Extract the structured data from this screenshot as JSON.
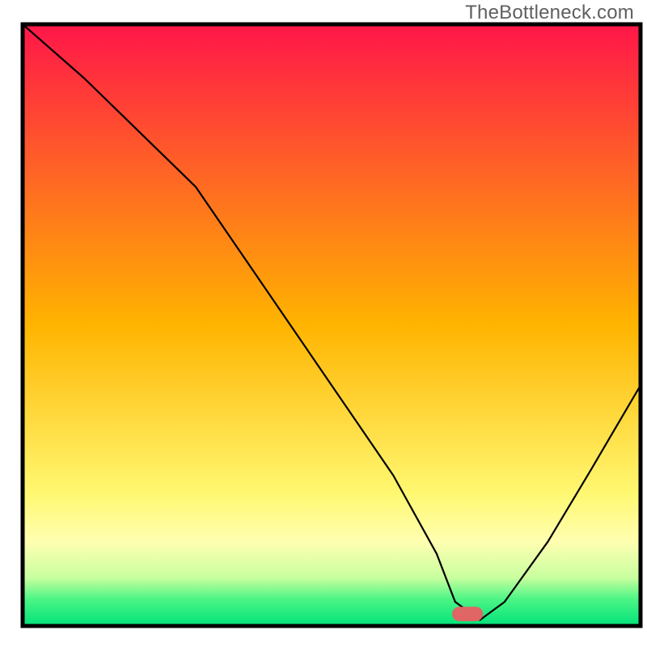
{
  "watermark": "TheBottleneck.com",
  "chart_data": {
    "type": "line",
    "title": "",
    "xlabel": "",
    "ylabel": "",
    "xlim": [
      0,
      100
    ],
    "ylim": [
      0,
      100
    ],
    "axes_visible": false,
    "border": true,
    "background_gradient": {
      "stops": [
        {
          "offset": 0.0,
          "color": "#ff1649"
        },
        {
          "offset": 0.5,
          "color": "#ffb400"
        },
        {
          "offset": 0.78,
          "color": "#fff871"
        },
        {
          "offset": 0.86,
          "color": "#ffffb1"
        },
        {
          "offset": 0.92,
          "color": "#c8ff9e"
        },
        {
          "offset": 0.955,
          "color": "#4df585"
        },
        {
          "offset": 1.0,
          "color": "#00e27a"
        }
      ]
    },
    "marker": {
      "x": 72,
      "y": 2,
      "color": "#e06666",
      "width_pct": 5,
      "height_pct": 2.4
    },
    "series": [
      {
        "name": "bottleneck-curve",
        "color": "#000000",
        "stroke_width": 2.2,
        "x": [
          0,
          10,
          20,
          28,
          40,
          52,
          60,
          67,
          70,
          74,
          78,
          85,
          92,
          100
        ],
        "y": [
          100,
          91,
          81,
          73,
          55,
          37,
          25,
          12,
          4,
          1,
          4,
          14,
          26,
          40
        ]
      }
    ]
  }
}
